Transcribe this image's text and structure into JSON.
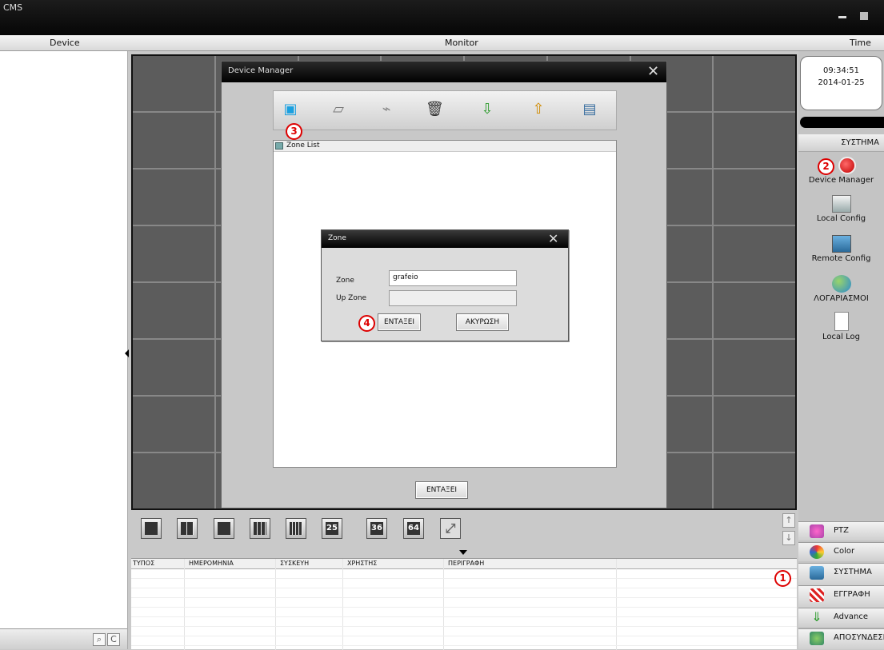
{
  "app": {
    "title": "CMS"
  },
  "menu": {
    "device": "Device",
    "monitor": "Monitor",
    "time": "Time"
  },
  "device_manager": {
    "title": "Device Manager",
    "zone_list": {
      "title": "Zone List"
    },
    "ok_label": "ΕΝΤΑΞΕΙ",
    "toolbar_icons": [
      "add-zone-icon",
      "add-device-icon",
      "modify-icon",
      "delete-icon",
      "import-icon",
      "export-icon",
      "ip-search-icon"
    ]
  },
  "zone_dialog": {
    "title": "Zone",
    "zone_label": "Zone",
    "zone_value": "grafeio",
    "upzone_label": "Up Zone",
    "upzone_value": "",
    "ok_label": "ΕΝΤΑΞΕΙ",
    "cancel_label": "ΑΚΥΡΩΣΗ"
  },
  "badges": {
    "b1": "1",
    "b2": "2",
    "b3": "3",
    "b4": "4"
  },
  "layouts": {
    "l25": "25",
    "l36": "36",
    "l64": "64"
  },
  "log": {
    "columns": [
      "ΤΥΠΟΣ",
      "ΗΜΕΡΟΜΗΝΙΑ",
      "ΣΥΣΚΕΥΗ",
      "ΧΡΗΣΤΗΣ",
      "ΠΕΡΙΓΡΑΦΗ"
    ]
  },
  "clock": {
    "time": "09:34:51",
    "date": "2014-01-25"
  },
  "system_panel": {
    "header": "ΣΥΣΤΗΜΑ",
    "items": [
      "Device Manager",
      "Local Config",
      "Remote Config",
      "ΛΟΓΑΡΙΑΣΜΟΙ",
      "Local Log"
    ]
  },
  "bottom_nav": {
    "ptz": "PTZ",
    "color": "Color",
    "system": "ΣΥΣΤΗΜΑ",
    "record": "ΕΓΓΡΑΦΗ",
    "advance": "Advance",
    "logout": "ΑΠΟΣΥΝΔΕΣΗ"
  }
}
